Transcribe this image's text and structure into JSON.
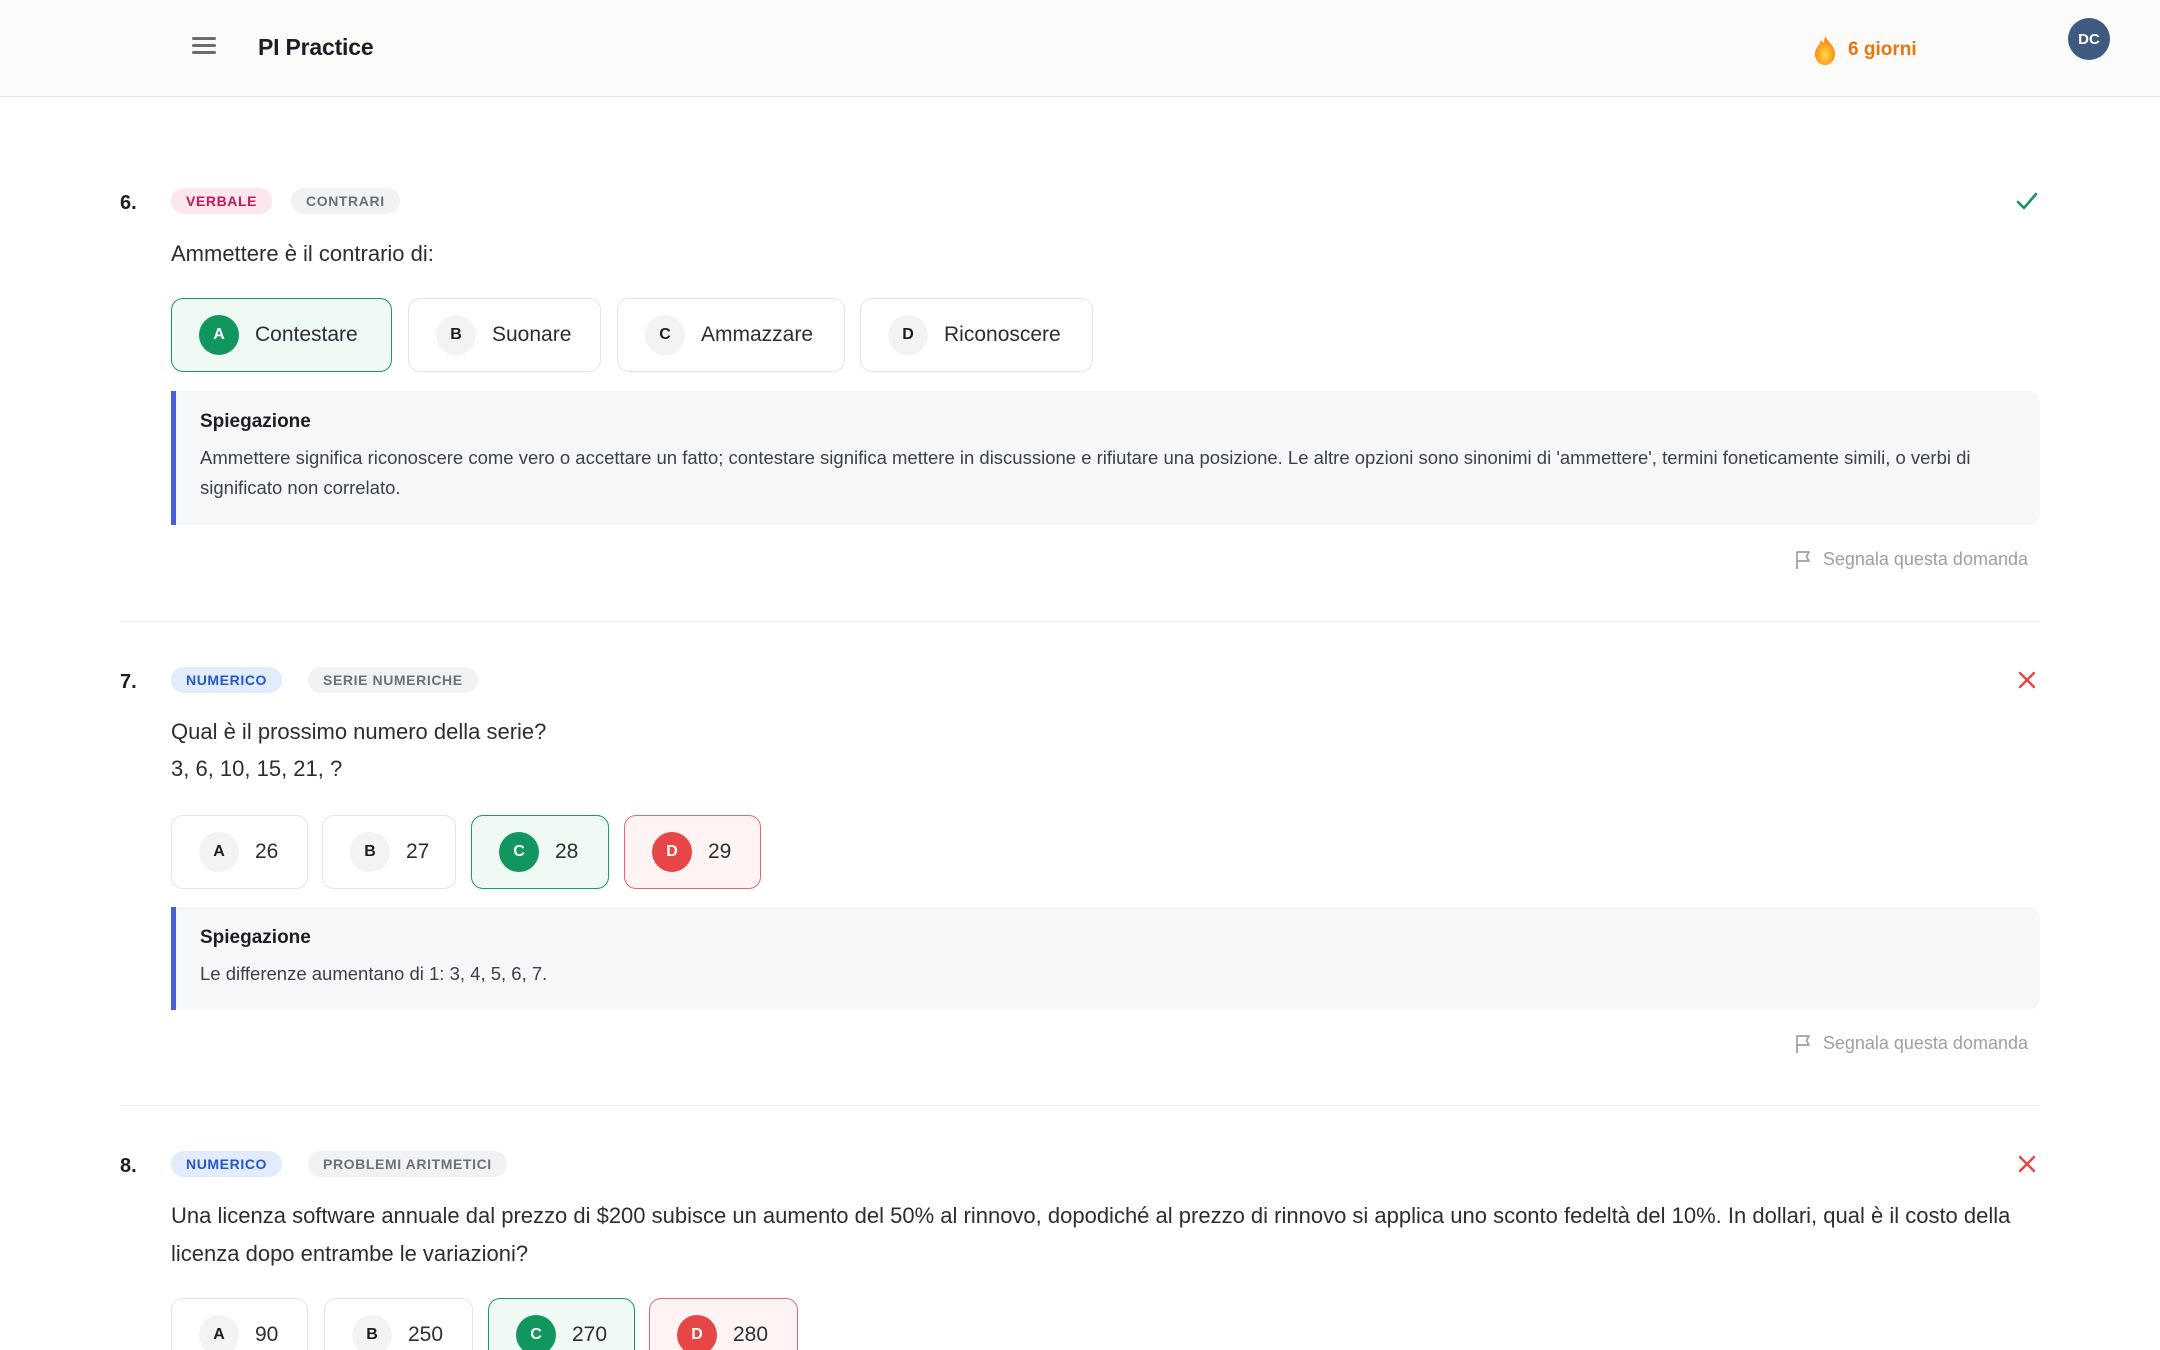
{
  "header": {
    "title": "PI Practice",
    "streak": "6 giorni",
    "avatar_initials": "DC",
    "menu_icon": "hamburger-icon",
    "streak_icon": "flame-icon"
  },
  "colors": {
    "correct": "#129660",
    "wrong": "#e64646",
    "streak": "#e8740c",
    "explanation_border": "#4660d9"
  },
  "questions": [
    {
      "number": "6.",
      "category": "VERBALE",
      "subcategory": "CONTRARI",
      "status": "correct",
      "status_icon": "check-icon",
      "text": "Ammettere è il contrario di:",
      "options": [
        {
          "letter": "A",
          "text": "Contestare",
          "state": "correct"
        },
        {
          "letter": "B",
          "text": "Suonare",
          "state": "neutral"
        },
        {
          "letter": "C",
          "text": "Ammazzare",
          "state": "neutral"
        },
        {
          "letter": "D",
          "text": "Riconoscere",
          "state": "neutral"
        }
      ],
      "explanation_title": "Spiegazione",
      "explanation": "Ammettere significa riconoscere come vero o accettare un fatto; contestare significa mettere in discussione e rifiutare una posizione. Le altre opzioni sono sinonimi di 'ammettere', termini foneticamente simili, o verbi di significato non correlato.",
      "report_label": "Segnala questa domanda"
    },
    {
      "number": "7.",
      "category": "NUMERICO",
      "subcategory": "SERIE NUMERICHE",
      "status": "wrong",
      "status_icon": "x-icon",
      "text": "Qual è il prossimo numero della serie?",
      "text_line2": "3, 6, 10, 15, 21, ?",
      "options": [
        {
          "letter": "A",
          "text": "26",
          "state": "neutral"
        },
        {
          "letter": "B",
          "text": "27",
          "state": "neutral"
        },
        {
          "letter": "C",
          "text": "28",
          "state": "correct"
        },
        {
          "letter": "D",
          "text": "29",
          "state": "wrong"
        }
      ],
      "explanation_title": "Spiegazione",
      "explanation": "Le differenze aumentano di 1: 3, 4, 5, 6, 7.",
      "report_label": "Segnala questa domanda"
    },
    {
      "number": "8.",
      "category": "NUMERICO",
      "subcategory": "PROBLEMI ARITMETICI",
      "status": "wrong",
      "status_icon": "x-icon",
      "text": "Una licenza software annuale dal prezzo di $200 subisce un aumento del 50% al rinnovo, dopodiché al prezzo di rinnovo si applica uno sconto fedeltà del 10%. In dollari, qual è il costo della licenza dopo entrambe le variazioni?",
      "options": [
        {
          "letter": "A",
          "text": "90",
          "state": "neutral"
        },
        {
          "letter": "B",
          "text": "250",
          "state": "neutral"
        },
        {
          "letter": "C",
          "text": "270",
          "state": "correct"
        },
        {
          "letter": "D",
          "text": "280",
          "state": "wrong"
        }
      ]
    }
  ]
}
